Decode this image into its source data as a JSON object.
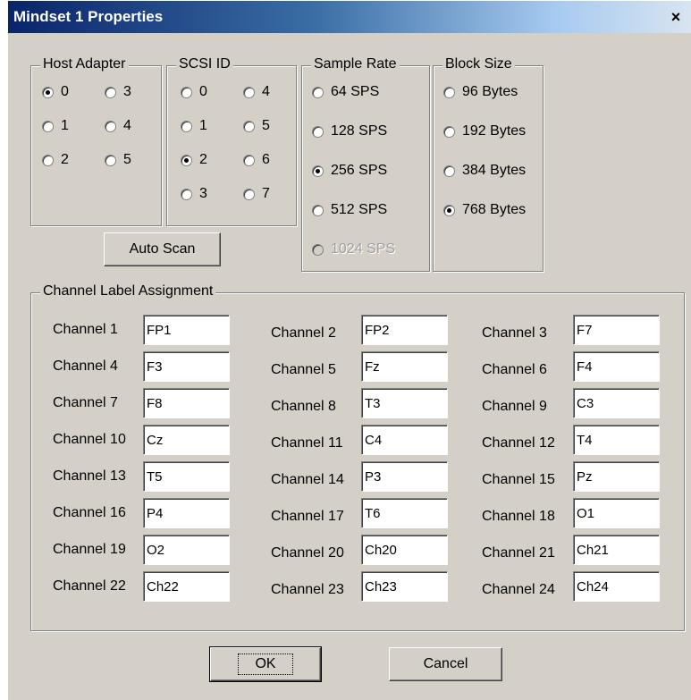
{
  "window": {
    "title": "Mindset 1 Properties",
    "close_glyph": "×"
  },
  "host_adapter": {
    "title": "Host Adapter",
    "options": [
      {
        "label": "0",
        "checked": true
      },
      {
        "label": "1",
        "checked": false
      },
      {
        "label": "2",
        "checked": false
      },
      {
        "label": "3",
        "checked": false
      },
      {
        "label": "4",
        "checked": false
      },
      {
        "label": "5",
        "checked": false
      }
    ]
  },
  "scsi_id": {
    "title": "SCSI ID",
    "options": [
      {
        "label": "0",
        "checked": false
      },
      {
        "label": "1",
        "checked": false
      },
      {
        "label": "2",
        "checked": true
      },
      {
        "label": "3",
        "checked": false
      },
      {
        "label": "4",
        "checked": false
      },
      {
        "label": "5",
        "checked": false
      },
      {
        "label": "6",
        "checked": false
      },
      {
        "label": "7",
        "checked": false
      }
    ]
  },
  "sample_rate": {
    "title": "Sample Rate",
    "options": [
      {
        "label": "64 SPS",
        "checked": false,
        "enabled": true
      },
      {
        "label": "128 SPS",
        "checked": false,
        "enabled": true
      },
      {
        "label": "256 SPS",
        "checked": true,
        "enabled": true
      },
      {
        "label": "512 SPS",
        "checked": false,
        "enabled": true
      },
      {
        "label": "1024 SPS",
        "checked": false,
        "enabled": false
      }
    ]
  },
  "block_size": {
    "title": "Block Size",
    "options": [
      {
        "label": "96 Bytes",
        "checked": false
      },
      {
        "label": "192 Bytes",
        "checked": false
      },
      {
        "label": "384 Bytes",
        "checked": false
      },
      {
        "label": "768 Bytes",
        "checked": true
      }
    ]
  },
  "auto_scan_label": "Auto Scan",
  "channels": {
    "title": "Channel Label Assignment",
    "items": [
      {
        "label": "Channel 1",
        "value": "FP1"
      },
      {
        "label": "Channel 2",
        "value": "FP2"
      },
      {
        "label": "Channel 3",
        "value": "F7"
      },
      {
        "label": "Channel 4",
        "value": "F3"
      },
      {
        "label": "Channel 5",
        "value": "Fz"
      },
      {
        "label": "Channel 6",
        "value": "F4"
      },
      {
        "label": "Channel 7",
        "value": "F8"
      },
      {
        "label": "Channel 8",
        "value": "T3"
      },
      {
        "label": "Channel 9",
        "value": "C3"
      },
      {
        "label": "Channel 10",
        "value": "Cz"
      },
      {
        "label": "Channel 11",
        "value": "C4"
      },
      {
        "label": "Channel 12",
        "value": "T4"
      },
      {
        "label": "Channel 13",
        "value": "T5"
      },
      {
        "label": "Channel 14",
        "value": "P3"
      },
      {
        "label": "Channel 15",
        "value": "Pz"
      },
      {
        "label": "Channel 16",
        "value": "P4"
      },
      {
        "label": "Channel 17",
        "value": "T6"
      },
      {
        "label": "Channel 18",
        "value": "O1"
      },
      {
        "label": "Channel 19",
        "value": "O2"
      },
      {
        "label": "Channel 20",
        "value": "Ch20"
      },
      {
        "label": "Channel 21",
        "value": "Ch21"
      },
      {
        "label": "Channel 22",
        "value": "Ch22"
      },
      {
        "label": "Channel 23",
        "value": "Ch23"
      },
      {
        "label": "Channel 24",
        "value": "Ch24"
      }
    ]
  },
  "buttons": {
    "ok": "OK",
    "cancel": "Cancel"
  }
}
